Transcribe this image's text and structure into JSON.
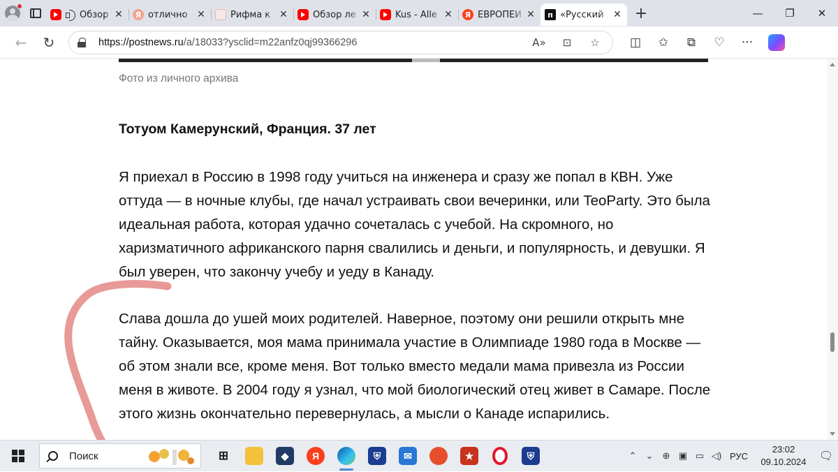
{
  "browser": {
    "tabs": [
      {
        "favicon": "youtube",
        "title": "Обзор",
        "audio": true,
        "active": false
      },
      {
        "favicon": "yandex-dim",
        "title": "отлично",
        "active": false
      },
      {
        "favicon": "doc",
        "title": "Рифма к",
        "active": false
      },
      {
        "favicon": "youtube",
        "title": "Обзор ле",
        "active": false
      },
      {
        "favicon": "youtube",
        "title": "Kus - Alle",
        "active": false
      },
      {
        "favicon": "yandex",
        "title": "ЕВРОПЕЙ",
        "active": false
      },
      {
        "favicon": "postnews",
        "title": "«Русский",
        "active": true
      }
    ],
    "address": {
      "host": "https://postnews.ru",
      "path": "/a/18033?ysclid=m22anfz0qj99366296"
    }
  },
  "article": {
    "caption": "Фото из личного архива",
    "heading": "Тотуом Камерунский, Франция. 37 лет",
    "paragraph1": "Я приехал в Россию в 1998 году учиться на инженера и сразу же попал в КВН. Уже оттуда — в ночные клубы, где начал устраивать свои вечеринки, или TeoParty. Это была идеальная работа, которая удачно сочеталась с учебой. На скромного, но харизматичного африканского парня свалились и деньги, и популярность, и девушки. Я был уверен, что закончу учебу и уеду в Канаду.",
    "paragraph2": "Слава дошла до ушей моих родителей. Наверное, поэтому они решили открыть мне тайну. Оказывается, моя мама принимала участие в Олимпиаде 1980 года в Москве — об этом знали все, кроме меня. Вот только вместо медали мама привезла из России меня в животе. В 2004 году я узнал, что мой биологический отец живет в Самаре. После этого жизнь окончательно перевернулась, а мысли о Канаде испарились."
  },
  "taskbar": {
    "search_placeholder": "Поиск",
    "language": "РУС",
    "time": "23:02",
    "date": "09.10.2024"
  },
  "colors": {
    "scribble": "#e48f8c",
    "tabbar_bg": "#dfe3e9",
    "taskbar_bg": "#e9ecf0"
  }
}
